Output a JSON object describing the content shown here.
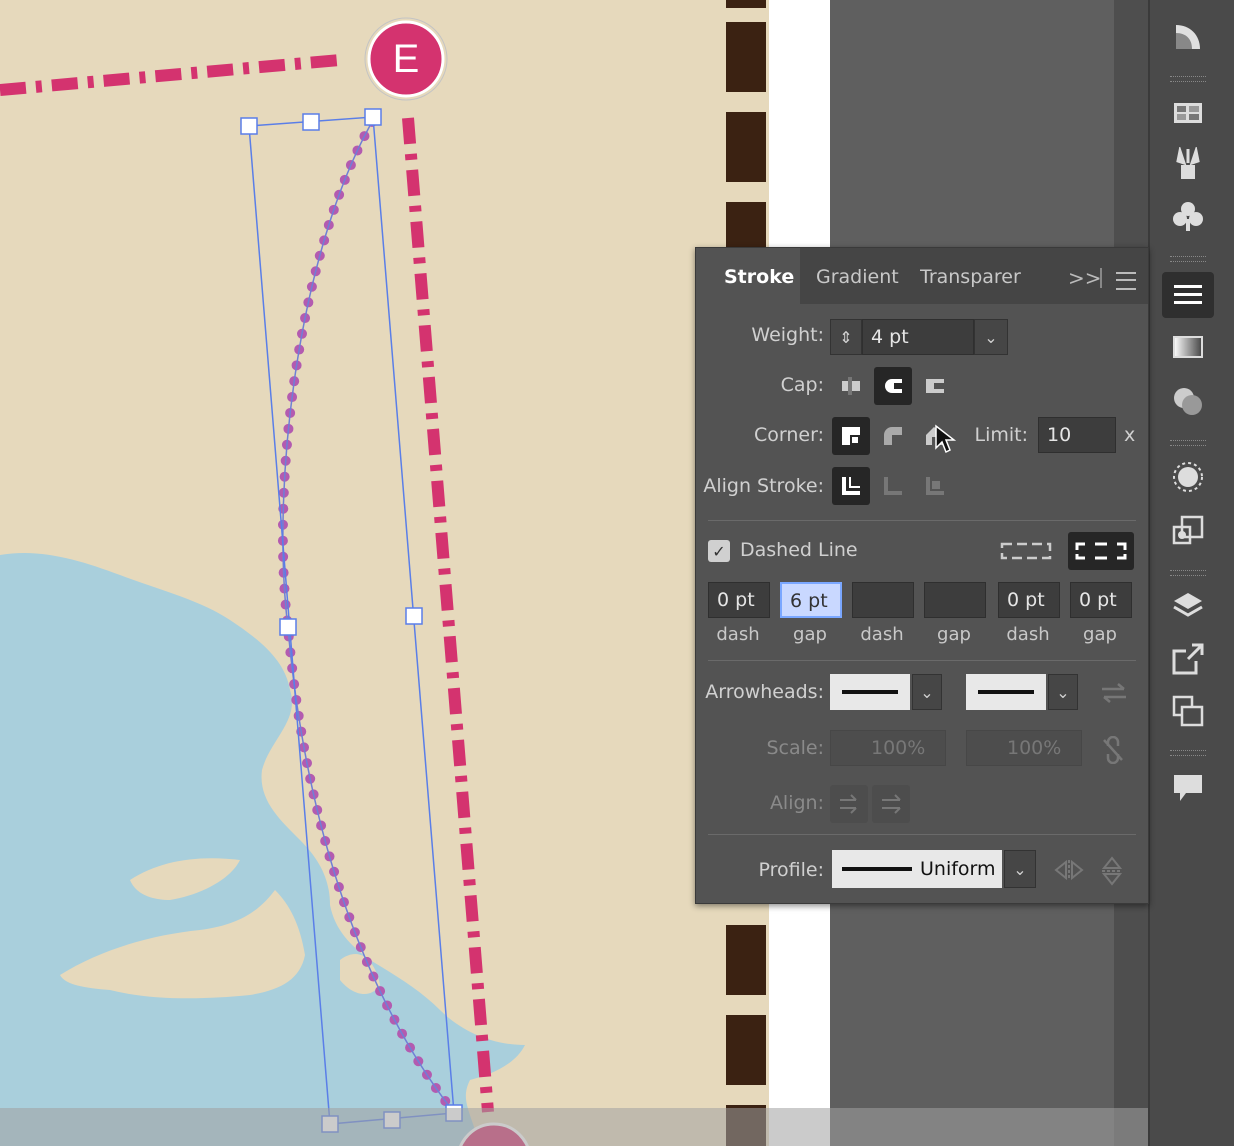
{
  "colors": {
    "paper": "#e6d9bc",
    "water": "#a9cfdc",
    "route_magenta": "#d4336f",
    "path_purple": "#b35bb0",
    "selection_blue": "#5a7ee8",
    "film_dark": "#3b2212",
    "panel_bg": "#535353"
  },
  "canvas": {
    "marker_label": "E"
  },
  "stroke_panel": {
    "tabs": [
      {
        "label": "Stroke",
        "active": true
      },
      {
        "label": "Gradient",
        "active": false
      },
      {
        "label": "Transparer",
        "active": false
      }
    ],
    "menu_overflow": ">>",
    "weight": {
      "label": "Weight:",
      "value": "4 pt"
    },
    "cap": {
      "label": "Cap:",
      "options": [
        "butt-cap-icon",
        "round-cap-icon",
        "projecting-cap-icon"
      ],
      "selected": "round-cap-icon"
    },
    "corner": {
      "label": "Corner:",
      "options": [
        "miter-join-icon",
        "round-join-icon",
        "bevel-join-icon"
      ],
      "selected": "miter-join-icon"
    },
    "limit": {
      "label": "Limit:",
      "value": "10",
      "suffix": "x"
    },
    "align_stroke": {
      "label": "Align Stroke:",
      "options": [
        "align-center-icon",
        "align-inside-icon",
        "align-outside-icon"
      ],
      "selected": "align-center-icon"
    },
    "dashed_line": {
      "label": "Dashed Line",
      "checked": true
    },
    "dash_fields": [
      {
        "value": "0 pt",
        "label": "dash"
      },
      {
        "value": "6 pt",
        "label": "gap",
        "focused": true
      },
      {
        "value": "",
        "label": "dash"
      },
      {
        "value": "",
        "label": "gap"
      },
      {
        "value": "0 pt",
        "label": "dash"
      },
      {
        "value": "0 pt",
        "label": "gap"
      }
    ],
    "arrowheads": {
      "label": "Arrowheads:"
    },
    "scale": {
      "label": "Scale:",
      "start": "100%",
      "end": "100%"
    },
    "align": {
      "label": "Align:"
    },
    "profile": {
      "label": "Profile:",
      "value": "Uniform"
    }
  },
  "right_toolbar": {
    "icons": [
      "color-guide-icon",
      "swatches-icon",
      "brushes-icon",
      "symbols-icon",
      "stroke-icon",
      "gradient-icon",
      "transparency-icon",
      "appearance-icon",
      "graphic-styles-icon",
      "layers-icon",
      "export-icon",
      "artboards-icon",
      "comments-icon"
    ],
    "active": "stroke-icon"
  }
}
